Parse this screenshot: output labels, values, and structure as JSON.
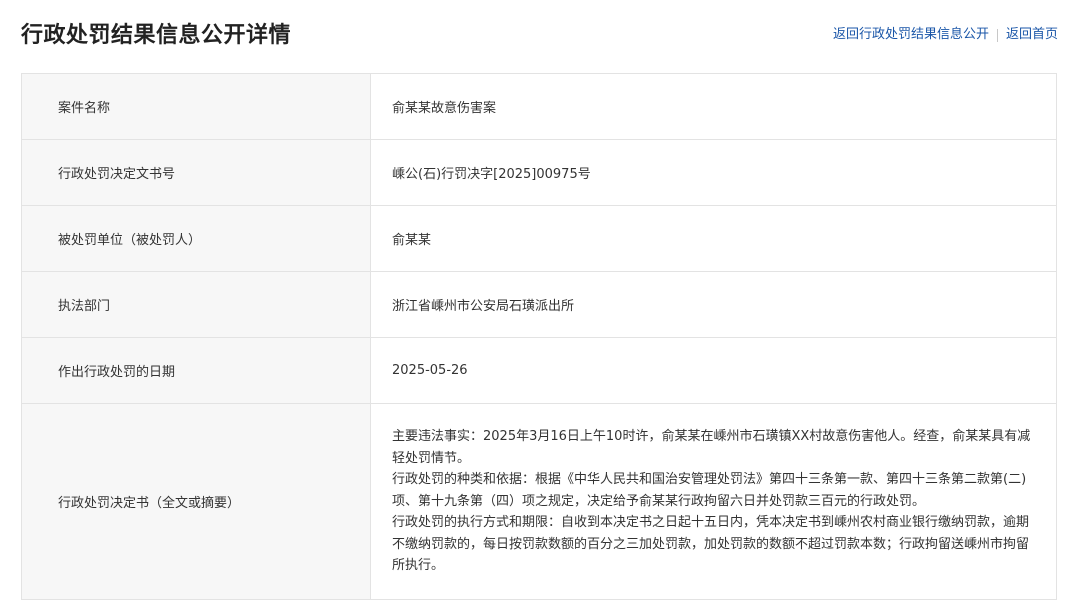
{
  "header": {
    "title": "行政处罚结果信息公开详情",
    "links": {
      "back_to_list": "返回行政处罚结果信息公开",
      "back_home": "返回首页"
    }
  },
  "rows": [
    {
      "label": "案件名称",
      "value": "俞某某故意伤害案"
    },
    {
      "label": "行政处罚决定文书号",
      "value": "嵊公(石)行罚决字[2025]00975号"
    },
    {
      "label": "被处罚单位（被处罚人）",
      "value": "俞某某"
    },
    {
      "label": "执法部门",
      "value": "浙江省嵊州市公安局石璜派出所"
    },
    {
      "label": "作出行政处罚的日期",
      "value": "2025-05-26"
    }
  ],
  "decision": {
    "label": "行政处罚决定书（全文或摘要）",
    "paragraphs": [
      "主要违法事实：2025年3月16日上午10时许，俞某某在嵊州市石璜镇XX村故意伤害他人。经查，俞某某具有减轻处罚情节。",
      "行政处罚的种类和依据：根据《中华人民共和国治安管理处罚法》第四十三条第一款、第四十三条第二款第(二)项、第十九条第（四）项之规定，决定给予俞某某行政拘留六日并处罚款三百元的行政处罚。",
      "行政处罚的执行方式和期限：自收到本决定书之日起十五日内，凭本决定书到嵊州农村商业银行缴纳罚款，逾期不缴纳罚款的，每日按罚款数额的百分之三加处罚款，加处罚款的数额不超过罚款本数；行政拘留送嵊州市拘留所执行。"
    ]
  }
}
